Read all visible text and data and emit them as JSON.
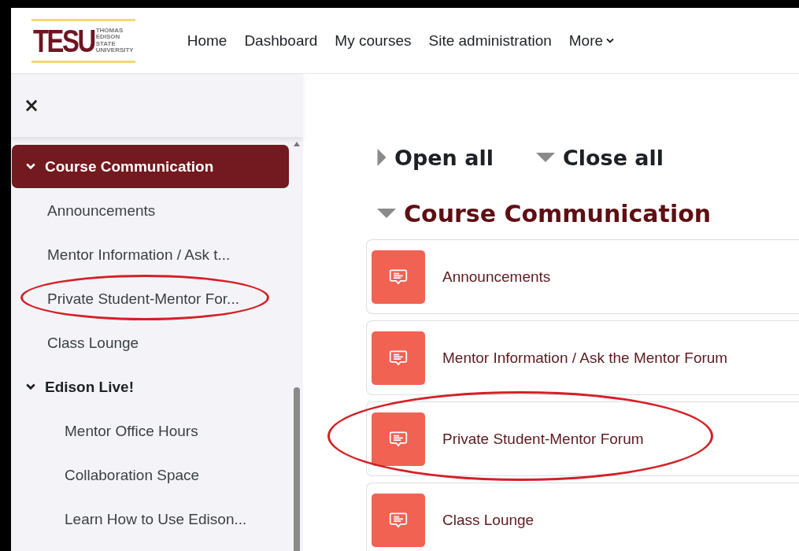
{
  "logo": {
    "mark": "TESU",
    "lines": [
      "THOMAS",
      "EDISON",
      "STATE",
      "UNIVERSITY"
    ]
  },
  "nav": [
    {
      "label": "Home",
      "menu": false
    },
    {
      "label": "Dashboard",
      "menu": false
    },
    {
      "label": "My courses",
      "menu": false
    },
    {
      "label": "Site administration",
      "menu": false
    },
    {
      "label": "More",
      "menu": true
    }
  ],
  "sidebar": {
    "close": "×",
    "items": [
      {
        "label": "Course Communication",
        "expanded": true,
        "selected": true,
        "children": [
          {
            "label": "Announcements",
            "highlighted": false
          },
          {
            "label": "Mentor Information / Ask t...",
            "highlighted": false
          },
          {
            "label": "Private Student-Mentor For...",
            "highlighted": true
          },
          {
            "label": "Class Lounge",
            "highlighted": false
          }
        ]
      },
      {
        "label": "Edison Live!",
        "expanded": true,
        "selected": false,
        "children": [
          {
            "label": "Mentor Office Hours",
            "highlighted": false
          },
          {
            "label": "Collaboration Space",
            "highlighted": false
          },
          {
            "label": "Learn How to Use Edison...",
            "highlighted": false
          }
        ]
      }
    ]
  },
  "controls": [
    {
      "label": "Open all",
      "kind": "open"
    },
    {
      "label": "Close all",
      "kind": "close"
    }
  ],
  "section": {
    "title": "Course Communication",
    "expanded": true,
    "activities": [
      {
        "name": "Announcements",
        "highlighted": false
      },
      {
        "name": "Mentor Information / Ask the Mentor Forum",
        "highlighted": false
      },
      {
        "name": "Private Student-Mentor Forum",
        "highlighted": true
      },
      {
        "name": "Class Lounge",
        "highlighted": false
      }
    ]
  }
}
